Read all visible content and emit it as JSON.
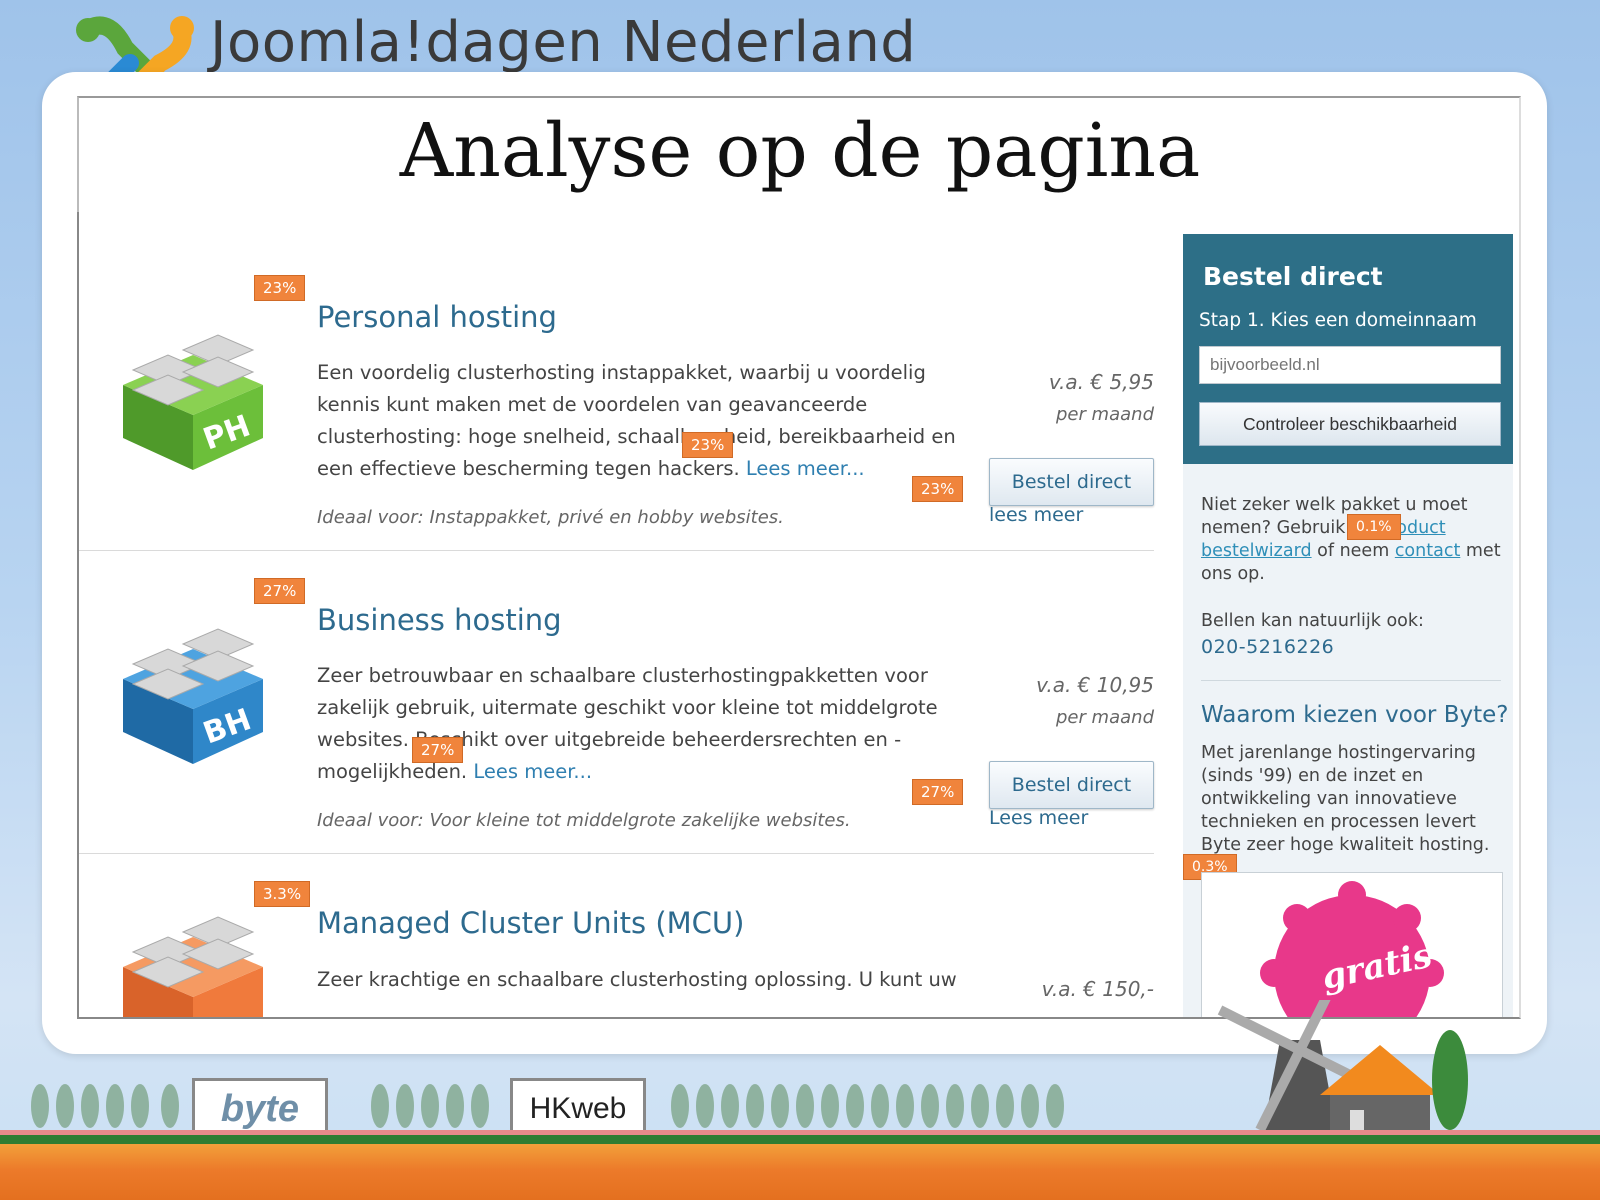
{
  "header": {
    "brand": "Joomla!dagen Nederland",
    "slide_title": "Analyse op de pagina"
  },
  "packages": [
    {
      "badge_title": "23%",
      "icon_label": "PH",
      "icon_color": "#6cbf3a",
      "title": "Personal hosting",
      "desc_part1": "Een voordelig clusterhosting instappakket, waarbij u voordelig kennis kunt maken met de voordelen van geavanceerde clusterhosting: hoge snelheid, schaalbaarheid, bereikbaarheid en een effectieve bescherming tegen hackers. ",
      "desc_more": "Lees meer...",
      "badge_more": "23%",
      "ideal": "Ideaal voor: Instappakket, privé en hobby websites.",
      "price": "v.a. € 5,95",
      "per": "per maand",
      "badge_btn": "23%",
      "button": "Bestel direct",
      "lees": "lees meer"
    },
    {
      "badge_title": "27%",
      "icon_label": "BH",
      "icon_color": "#2f87c9",
      "title": "Business hosting",
      "desc_part1": "Zeer betrouwbaar en schaalbare clusterhostingpakketten voor zakelijk gebruik, uitermate geschikt voor kleine tot middelgrote websites. Beschikt over uitgebreide beheerdersrechten en -mogelijkheden. ",
      "desc_more": "Lees meer...",
      "badge_more": "27%",
      "ideal": "Ideaal voor: Voor kleine tot middelgrote zakelijke websites.",
      "price": "v.a. € 10,95",
      "per": "per maand",
      "badge_btn": "27%",
      "button": "Bestel direct",
      "lees": "Lees meer"
    },
    {
      "badge_title": "3.3%",
      "icon_color": "#f07a3c",
      "title": "Managed Cluster Units (MCU)",
      "desc_part1": "Zeer krachtige en schaalbare clusterhosting oplossing. U kunt uw",
      "price": "v.a. € 150,-"
    }
  ],
  "sidebar": {
    "heading": "Bestel direct",
    "step": "Stap 1. Kies een domeinnaam",
    "input_placeholder": "bijvoorbeeld.nl",
    "check_button": "Controleer beschikbaarheid",
    "help_text_1": "Niet zeker welk pakket u moet nemen? Gebruik de ",
    "help_link_1": "product bestelwizard",
    "help_text_2": " of neem ",
    "help_link_2": "contact",
    "help_text_3": " met ons op.",
    "help_badge": "0.1%",
    "call_text": "Bellen kan natuurlijk ook:",
    "phone": "020-5216226",
    "why_heading": "Waarom kiezen voor Byte?",
    "why_text": "Met jarenlange hostingervaring (sinds '99) en de inzet en ontwikkeling van innovatieve technieken en processen levert Byte zeer hoge kwaliteit hosting.",
    "promo_badge": "0.3%",
    "promo_text": "gratis"
  },
  "footer": {
    "sponsor_1": "byte",
    "sponsor_2": "HKweb"
  }
}
